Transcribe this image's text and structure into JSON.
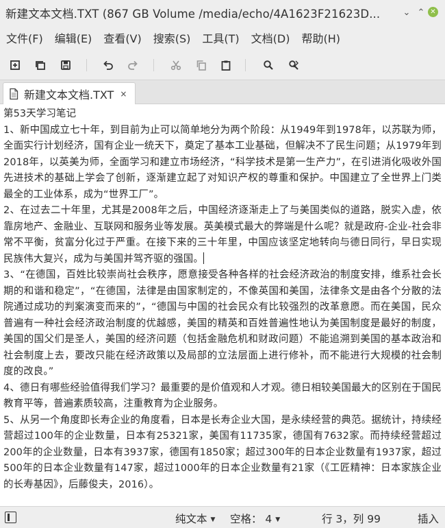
{
  "window": {
    "title": "新建文本文档.TXT (867 GB Volume /media/echo/4A1623F21623D...",
    "minimize_glyph": "⌄",
    "maximize_glyph": "⌃",
    "close_glyph": "✕"
  },
  "menu": [
    {
      "label": "文件(F)"
    },
    {
      "label": "编辑(E)"
    },
    {
      "label": "查看(V)"
    },
    {
      "label": "搜索(S)"
    },
    {
      "label": "工具(T)"
    },
    {
      "label": "文档(D)"
    },
    {
      "label": "帮助(H)"
    }
  ],
  "toolbar": {
    "icons": [
      "new-document-icon",
      "new-window-icon",
      "save-icon",
      "undo-icon",
      "redo-icon",
      "cut-icon",
      "copy-icon",
      "paste-icon",
      "search-icon",
      "find-replace-icon"
    ]
  },
  "tab": {
    "label": "新建文本文档.TXT",
    "close_glyph": "×"
  },
  "document": {
    "lines": [
      "第53天学习笔记",
      "1、新中国成立七十年，到目前为止可以简单地分为两个阶段：从1949年到1978年，以苏联为师，全面实行计划经济，国有企业一统天下，奠定了基本工业基础，但解决不了民生问题；从1979年到2018年，以英美为师，全面学习和建立市场经济，“科学技术是第一生产力”，在引进消化吸收外国先进技术的基础上学会了创新，逐渐建立起了对知识产权的尊重和保护。中国建立了全世界上门类最全的工业体系，成为“世界工厂”。",
      "2、在过去二十年里，尤其是2008年之后，中国经济逐渐走上了与美国类似的道路，脱实入虚，依靠房地产、金融业、互联网和服务业等发展。英美模式最大的弊端是什么呢？就是政府-企业-社会非常不平衡，贫富分化过于严重。在接下来的三十年里，中国应该坚定地转向与德日同行，早日实现民族伟大复兴，成为与美国并驾齐驱的强国。",
      "3、“在德国，百姓比较崇尚社会秩序，愿意接受各种各样的社会经济政治的制度安排，维系社会长期的和谐和稳定”，“在德国，法律是由国家制定的，不像英国和美国，法律条文是由各个分散的法院通过成功的判案演变而来的”，“德国与中国的社会民众有比较强烈的改革意愿。而在美国，民众普遍有一种社会经济政治制度的优越感，美国的精英和百姓普遍性地认为美国制度是最好的制度，美国的国父们是圣人，美国的经济问题（包括金融危机和财政问题）不能追溯到美国的基本政治和社会制度上去，要改只能在经济政策以及局部的立法层面上进行修补，而不能进行大规模的社会制度的改良。”",
      "4、德日有哪些经验值得我们学习？最重要的是价值观和人才观。德日相较美国最大的区别在于国民教育平等，普遍素质较高，注重教育为企业服务。",
      "5、从另一个角度即长寿企业的角度看，日本是长寿企业大国，是永续经营的典范。据统计，持续经营超过100年的企业数量，日本有25321家，美国有11735家，德国有7632家。而持续经营超过200年的企业数量，日本有3937家，德国有1850家；超过300年的日本企业数量有1937家，超过500年的日本企业数量有147家，超过1000年的日本企业数量有21家（《工匠精神：日本家族企业的长寿基因》，后藤俊夫，2016）。"
    ]
  },
  "status": {
    "language": "纯文本",
    "tab_width": "空格：  4",
    "position": "行 3，列 99",
    "mode": "插入"
  }
}
